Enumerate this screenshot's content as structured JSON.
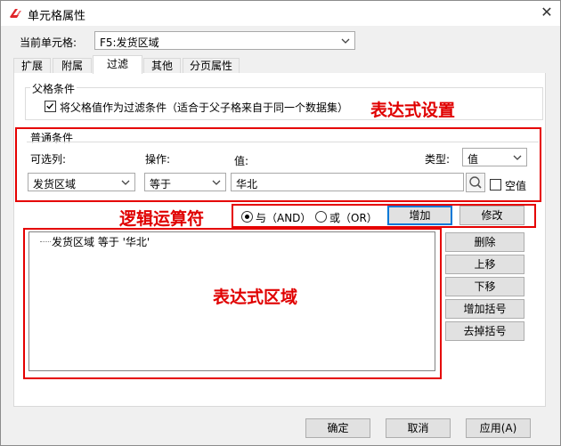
{
  "window": {
    "title": "单元格属性",
    "close_label": "✕"
  },
  "current_cell": {
    "label": "当前单元格:",
    "value": "F5:发货区域"
  },
  "tabs": [
    {
      "label": "扩展"
    },
    {
      "label": "附属"
    },
    {
      "label": "过滤",
      "active": true
    },
    {
      "label": "其他"
    },
    {
      "label": "分页属性"
    }
  ],
  "parent_condition": {
    "group_label": "父格条件",
    "checkbox_label": "将父格值作为过滤条件（适合于父子格来自于同一个数据集）",
    "checked": true
  },
  "normal_condition": {
    "group_label": "普通条件",
    "column_label": "可选列:",
    "column_value": "发货区域",
    "operator_label": "操作:",
    "operator_value": "等于",
    "value_label": "值:",
    "value_input": "华北",
    "type_label": "类型:",
    "type_value": "值",
    "empty_label": "空值",
    "empty_checked": false
  },
  "logic": {
    "and_label": "与（AND）",
    "or_label": "或（OR）",
    "selected": "and",
    "add_button": "增加",
    "modify_button": "修改"
  },
  "expression_list": {
    "items": [
      "发货区域 等于 '华北'"
    ]
  },
  "side_buttons": {
    "delete": "删除",
    "move_up": "上移",
    "move_down": "下移",
    "add_bracket": "增加括号",
    "remove_bracket": "去掉括号"
  },
  "annotations": {
    "expression_setting": "表达式设置",
    "logic_operator": "逻辑运算符",
    "expression_area": "表达式区域"
  },
  "footer": {
    "ok": "确定",
    "cancel": "取消",
    "apply": "应用(A)"
  },
  "colors": {
    "annotation": "#e00000",
    "accent_border": "#0078d7",
    "app_icon": "#e0262b"
  }
}
